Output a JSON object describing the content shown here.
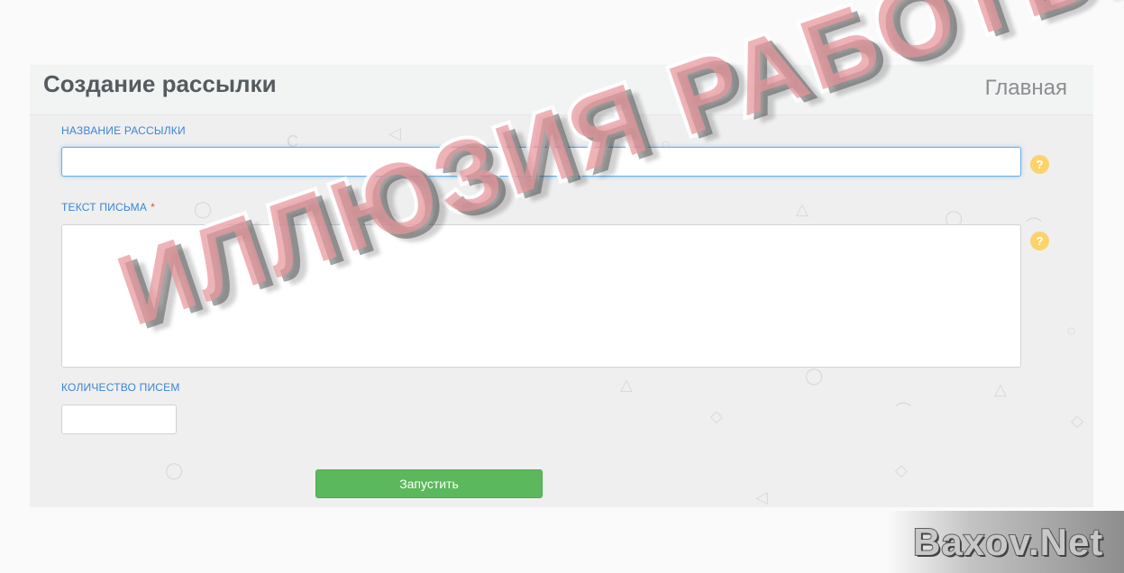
{
  "header": {
    "title": "Создание рассылки",
    "home_link": "Главная"
  },
  "form": {
    "name_field": {
      "label": "НАЗВАНИЕ РАССЫЛКИ",
      "value": "",
      "placeholder": ""
    },
    "body_field": {
      "label": "ТЕКСТ ПИСЬМА",
      "required_mark": "*",
      "value": "",
      "placeholder": ""
    },
    "count_field": {
      "label": "КОЛИЧЕСТВО ПИСЕМ",
      "value": "",
      "placeholder": ""
    },
    "help_icon_glyph": "?",
    "submit_label": "Запустить"
  },
  "overlay": {
    "stamp_text": "ИЛЛЮЗИЯ РАБОТЫ",
    "watermark_text": "Baxov.Net"
  },
  "colors": {
    "label_blue": "#3a86d6",
    "button_green": "#5cb85c",
    "help_yellow": "#fcd36b",
    "stamp_red": "#e8969b"
  }
}
